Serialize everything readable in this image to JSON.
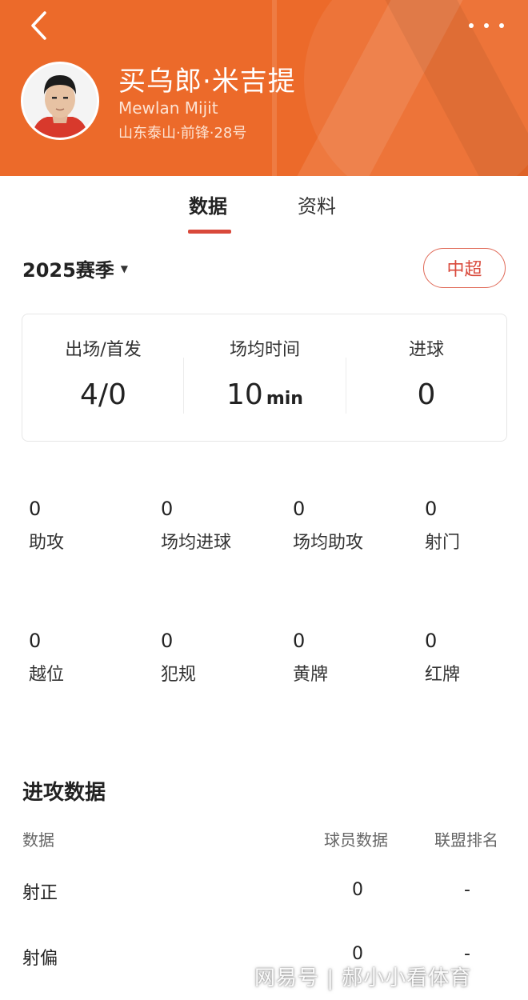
{
  "header": {
    "name_cn": "买乌郎·米吉提",
    "name_en": "Mewlan Mijit",
    "team_info": "山东泰山·前锋·28号"
  },
  "tabs": [
    {
      "label": "数据",
      "active": true
    },
    {
      "label": "资料",
      "active": false
    }
  ],
  "season": {
    "label": "2025赛季",
    "league_label": "中超"
  },
  "summary": [
    {
      "label": "出场/首发",
      "value": "4/0",
      "unit": ""
    },
    {
      "label": "场均时间",
      "value": "10",
      "unit": "min"
    },
    {
      "label": "进球",
      "value": "0",
      "unit": ""
    }
  ],
  "stats": [
    {
      "value": "0",
      "label": "助攻"
    },
    {
      "value": "0",
      "label": "场均进球"
    },
    {
      "value": "0",
      "label": "场均助攻"
    },
    {
      "value": "0",
      "label": "射门"
    },
    {
      "value": "0",
      "label": "越位"
    },
    {
      "value": "0",
      "label": "犯规"
    },
    {
      "value": "0",
      "label": "黄牌"
    },
    {
      "value": "0",
      "label": "红牌"
    }
  ],
  "attack": {
    "title": "进攻数据",
    "columns": [
      "数据",
      "球员数据",
      "联盟排名"
    ],
    "rows": [
      {
        "name": "射正",
        "player_value": "0",
        "rank": "-"
      },
      {
        "name": "射偏",
        "player_value": "0",
        "rank": "-"
      }
    ]
  },
  "watermark": "网易号 | 郝小小看体育",
  "colors": {
    "header_bg": "#ec6a2a",
    "accent": "#d9493b"
  }
}
